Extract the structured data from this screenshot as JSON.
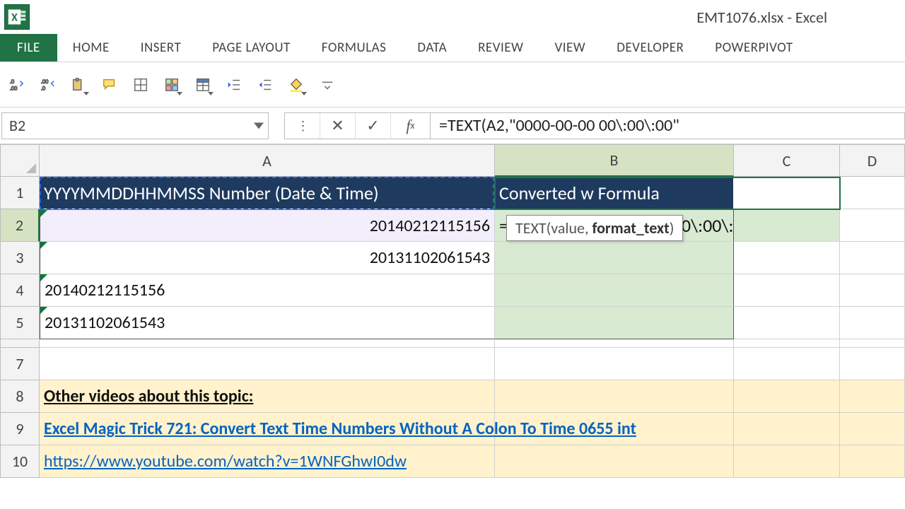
{
  "title": "EMT1076.xlsx - Excel",
  "tabs": {
    "file": "FILE",
    "home": "HOME",
    "insert": "INSERT",
    "page_layout": "PAGE LAYOUT",
    "formulas": "FORMULAS",
    "data": "DATA",
    "review": "REVIEW",
    "view": "VIEW",
    "developer": "DEVELOPER",
    "powerpivot": "POWERPIVOT"
  },
  "name_box": "B2",
  "formula_bar": "=TEXT(A2,\"0000-00-00 00\\:00\\:00\"",
  "columns": {
    "A": "A",
    "B": "B",
    "C": "C",
    "D": "D"
  },
  "rows": [
    "1",
    "2",
    "3",
    "4",
    "5",
    "7",
    "8",
    "9",
    "10"
  ],
  "cells": {
    "A1": "YYYYMMDDHHMMSS Number (Date & Time)",
    "B1": "Converted w Formula",
    "A2": "20140212115156",
    "A3": "20131102061543",
    "A4": "20140212115156",
    "A5": "20131102061543",
    "B2_formula_prefix": "=TEXT(",
    "B2_formula_ref": "A2",
    "B2_formula_suffix": ",\"0000-00-00 00\\:00\\:00\"",
    "A8": "Other videos about this topic:",
    "A9": "Excel Magic Trick 721: Convert Text Time Numbers Without A Colon To Time 0655 int",
    "A10": "https://www.youtube.com/watch?v=1WNFGhwI0dw"
  },
  "tooltip": {
    "fn": "TEXT",
    "sig_prefix": "(value, ",
    "sig_bold": "format_text",
    "sig_suffix": ")"
  }
}
